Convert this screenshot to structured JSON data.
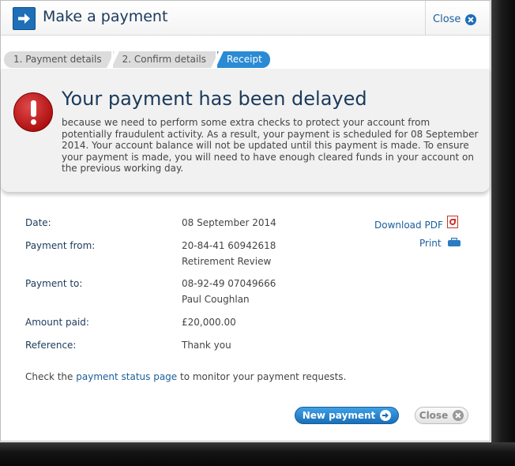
{
  "header": {
    "title": "Make a payment",
    "close_label": "Close"
  },
  "steps": [
    {
      "label": "1. Payment details",
      "state": "completed"
    },
    {
      "label": "2. Confirm details",
      "state": "completed"
    },
    {
      "label": "Receipt",
      "state": "active"
    }
  ],
  "alert": {
    "title": "Your payment has been delayed",
    "message": "because we need to perform some extra checks to protect your account from potentially fraudulent activity. As a result, your payment is scheduled for 08 September 2014. Your account balance will not be updated until this payment is made. To ensure your payment is made, you will need to have enough cleared funds in your account on the previous working day."
  },
  "details": {
    "date": {
      "label": "Date:",
      "value": "08 September 2014"
    },
    "payment_from": {
      "label": "Payment from:",
      "account": "20-84-41 60942618",
      "name": "Retirement Review"
    },
    "payment_to": {
      "label": "Payment to:",
      "account": "08-92-49 07049666",
      "name": "Paul Coughlan"
    },
    "amount": {
      "label": "Amount paid:",
      "value": "£20,000.00"
    },
    "reference": {
      "label": "Reference:",
      "value": "Thank you"
    }
  },
  "actions": {
    "download_pdf": "Download PDF",
    "print": "Print"
  },
  "status_line": {
    "before": "Check the ",
    "link": "payment status page",
    "after": " to monitor your payment requests."
  },
  "buttons": {
    "new_payment": "New payment",
    "close": "Close"
  },
  "colors": {
    "accent": "#1e6fb8",
    "active_step": "#2a8ad4",
    "alert_red": "#b01212",
    "title_text": "#1a3a5c"
  }
}
